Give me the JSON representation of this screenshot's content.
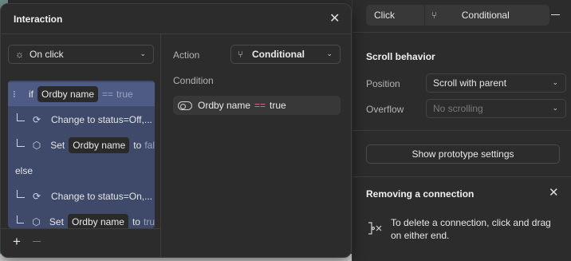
{
  "modal": {
    "title": "Interaction",
    "trigger": {
      "value": "On click",
      "icon": "click-icon"
    },
    "logic": {
      "if_keyword": "if",
      "condition_variable": "Ordby name",
      "condition_operator": "==",
      "condition_value": "true",
      "then_rows": [
        {
          "type": "change",
          "text": "Change to status=Off,..."
        },
        {
          "type": "set",
          "keyword": "Set",
          "variable": "Ordby name",
          "to": "to",
          "value": "fal"
        }
      ],
      "else_keyword": "else",
      "else_rows": [
        {
          "type": "change",
          "text": "Change to status=On,..."
        },
        {
          "type": "set",
          "keyword": "Set",
          "variable": "Ordby name",
          "to": "to",
          "value": "tru"
        }
      ]
    },
    "action": {
      "label": "Action",
      "value": "Conditional"
    },
    "condition": {
      "label": "Condition",
      "variable": "Ordby name",
      "operator": "==",
      "value": "true"
    },
    "footer": {
      "add_label": "+"
    }
  },
  "right_panel": {
    "trigger_label": "Click",
    "action_label": "Conditional",
    "scroll_behavior": {
      "title": "Scroll behavior",
      "position_label": "Position",
      "position_value": "Scroll with parent",
      "overflow_label": "Overflow",
      "overflow_value": "No scrolling"
    },
    "prototype_button": "Show prototype settings",
    "removing_connection": {
      "title": "Removing a connection",
      "text": "To delete a connection, click and drag on either end."
    }
  },
  "colors": {
    "panel_bg": "#2c2c2c",
    "logic_bg": "#3f4a6a",
    "logic_selected": "#4e5c85",
    "operator_pink": "#e86a9b"
  }
}
